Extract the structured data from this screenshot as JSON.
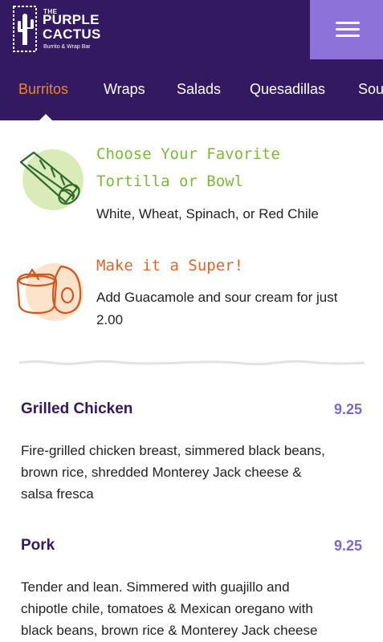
{
  "brand": {
    "the": "THE",
    "name_line1": "PURPLE",
    "name_line2": "CACTUS",
    "tagline": "Burrito & Wrap Bar"
  },
  "header": {
    "menu_icon": "hamburger-icon"
  },
  "nav": {
    "items": [
      "Burritos",
      "Wraps",
      "Salads",
      "Quesadillas",
      "Sou"
    ],
    "active": "Burritos"
  },
  "promos": [
    {
      "icon": "burrito-illustration",
      "title_line1": "Choose Your Favorite",
      "title_line2": "Tortilla or Bowl",
      "text": "White, Wheat, Spinach, or Red Chile",
      "color": "#7bb93a"
    },
    {
      "icon": "guacamole-illustration",
      "title": "Make it a Super!",
      "text_line1": "Add Guacamole and sour cream for just",
      "text_line2": "2.00",
      "color": "#e0642a"
    }
  ],
  "menu_items": [
    {
      "name": "Grilled Chicken",
      "price": "9.25",
      "desc_lines": [
        "Fire-grilled chicken breast, simmered black beans,",
        "brown rice, shredded Monterey Jack cheese &",
        "salsa fresca"
      ]
    },
    {
      "name": "Pork",
      "price": "9.25",
      "desc_lines": [
        "Tender and lean. Simmered with guajillo and",
        "chipotle chile, tomatoes & Mexican oregano with",
        "black beans, brown rice & Monterey Jack cheese"
      ]
    }
  ],
  "colors": {
    "header_bg": "#33195f",
    "menu_button_bg": "#8c72d9",
    "nav_active": "#e8862f",
    "item_name": "#33195f",
    "price": "#7c69c8"
  }
}
